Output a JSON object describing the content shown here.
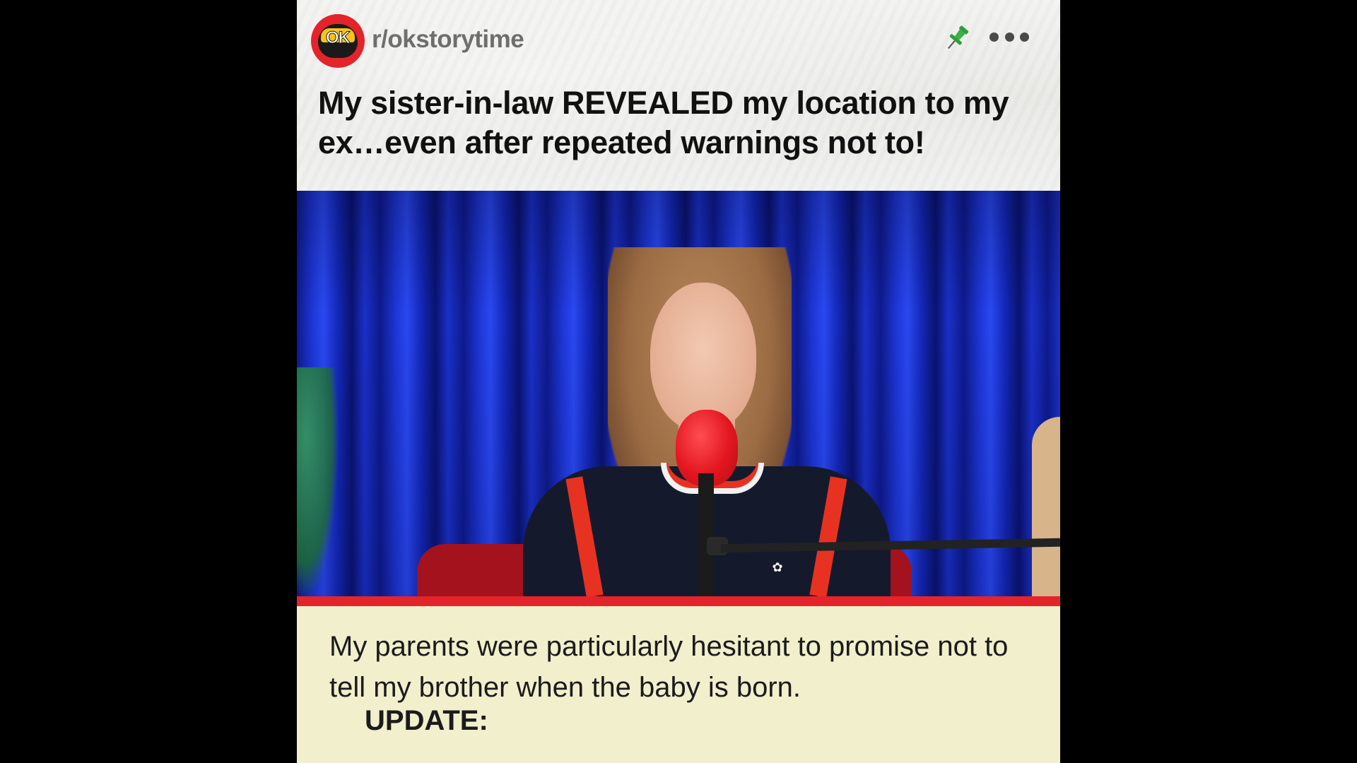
{
  "header": {
    "subreddit": "r/okstorytime",
    "logo_text": "OK",
    "post_title": "My sister-in-law REVEALED my location to my ex…even after repeated warnings not to!",
    "pin_icon": "pin-icon",
    "more_icon": "more-options-icon"
  },
  "caption": {
    "text": "My parents were particularly hesitant to promise not to tell my brother when the baby is born.",
    "update_label": "UPDATE:"
  },
  "colors": {
    "accent_red": "#e3242b",
    "caption_bg": "#f1efcc",
    "curtain_blue": "#1d36d6",
    "pin_green": "#2e9e3a"
  }
}
